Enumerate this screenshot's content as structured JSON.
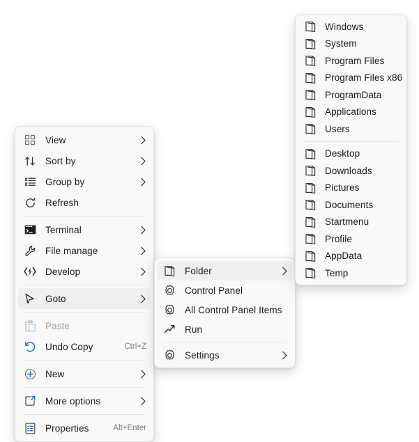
{
  "colors": {
    "menu_bg": "#F9F9F9",
    "menu_border": "#E2E2E2",
    "highlight": "#EFEFEF",
    "text": "#1a1a1a",
    "disabled_text": "#A0A0A0",
    "accent_blue": "#1F6FD0",
    "separator": "#E6E6E6"
  },
  "context_menu": {
    "name": "desktop-context-menu",
    "groups": [
      {
        "items": [
          {
            "label": "View",
            "icon": "grid-view-icon",
            "submenu": true,
            "accel": "",
            "disabled": false,
            "highlight": false
          },
          {
            "label": "Sort by",
            "icon": "sort-icon",
            "submenu": true,
            "accel": "",
            "disabled": false,
            "highlight": false
          },
          {
            "label": "Group by",
            "icon": "group-by-icon",
            "submenu": true,
            "accel": "",
            "disabled": false,
            "highlight": false
          },
          {
            "label": "Refresh",
            "icon": "refresh-icon",
            "submenu": false,
            "accel": "",
            "disabled": false,
            "highlight": false
          }
        ]
      },
      {
        "items": [
          {
            "label": "Terminal",
            "icon": "terminal-icon",
            "submenu": true,
            "accel": "",
            "disabled": false,
            "highlight": false
          },
          {
            "label": "File manage",
            "icon": "wrench-icon",
            "submenu": true,
            "accel": "",
            "disabled": false,
            "highlight": false
          },
          {
            "label": "Develop",
            "icon": "code-bolt-icon",
            "submenu": true,
            "accel": "",
            "disabled": false,
            "highlight": false
          }
        ]
      },
      {
        "items": [
          {
            "label": "Goto",
            "icon": "cursor-arrow-icon",
            "submenu": true,
            "accel": "",
            "disabled": false,
            "highlight": true
          }
        ]
      },
      {
        "items": [
          {
            "label": "Paste",
            "icon": "clipboard-icon",
            "submenu": false,
            "accel": "",
            "disabled": true,
            "highlight": false
          },
          {
            "label": "Undo Copy",
            "icon": "undo-icon",
            "submenu": false,
            "accel": "Ctrl+Z",
            "disabled": false,
            "highlight": false
          }
        ]
      },
      {
        "items": [
          {
            "label": "New",
            "icon": "plus-circle-icon",
            "submenu": true,
            "accel": "",
            "disabled": false,
            "highlight": false
          }
        ]
      },
      {
        "items": [
          {
            "label": "More options",
            "icon": "expand-box-icon",
            "submenu": true,
            "accel": "",
            "disabled": false,
            "highlight": false
          }
        ]
      },
      {
        "items": [
          {
            "label": "Properties",
            "icon": "properties-icon",
            "submenu": false,
            "accel": "Alt+Enter",
            "disabled": false,
            "highlight": false
          }
        ]
      }
    ]
  },
  "goto_submenu": {
    "name": "goto-submenu",
    "groups": [
      {
        "items": [
          {
            "label": "Folder",
            "icon": "folder-icon",
            "submenu": true,
            "highlight": true
          },
          {
            "label": "Control Panel",
            "icon": "gear-icon",
            "submenu": false,
            "highlight": false
          },
          {
            "label": "All Control Panel Items",
            "icon": "gear-icon",
            "submenu": false,
            "highlight": false
          },
          {
            "label": "Run",
            "icon": "run-icon",
            "submenu": false,
            "highlight": false
          }
        ]
      },
      {
        "items": [
          {
            "label": "Settings",
            "icon": "gear-icon",
            "submenu": true,
            "highlight": false
          }
        ]
      }
    ]
  },
  "folder_submenu": {
    "name": "folder-submenu",
    "groups": [
      {
        "items": [
          {
            "label": "Windows",
            "icon": "folder-icon"
          },
          {
            "label": "System",
            "icon": "folder-icon"
          },
          {
            "label": "Program Files",
            "icon": "folder-icon"
          },
          {
            "label": "Program Files x86",
            "icon": "folder-icon"
          },
          {
            "label": "ProgramData",
            "icon": "folder-icon"
          },
          {
            "label": "Applications",
            "icon": "folder-icon"
          },
          {
            "label": "Users",
            "icon": "folder-icon"
          }
        ]
      },
      {
        "items": [
          {
            "label": "Desktop",
            "icon": "folder-icon"
          },
          {
            "label": "Downloads",
            "icon": "folder-icon"
          },
          {
            "label": "Pictures",
            "icon": "folder-icon"
          },
          {
            "label": "Documents",
            "icon": "folder-icon"
          },
          {
            "label": "Startmenu",
            "icon": "folder-icon"
          },
          {
            "label": "Profile",
            "icon": "folder-icon"
          },
          {
            "label": "AppData",
            "icon": "folder-icon"
          },
          {
            "label": "Temp",
            "icon": "folder-icon"
          }
        ]
      }
    ]
  }
}
